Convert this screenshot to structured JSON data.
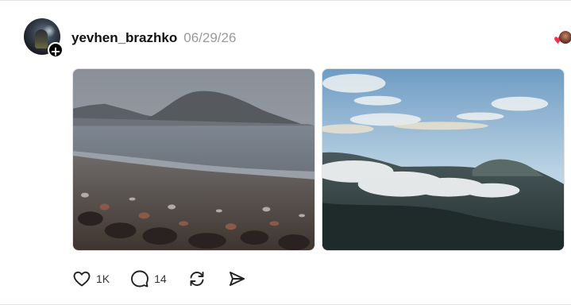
{
  "post": {
    "username": "yevhen_brazhko",
    "date": "06/29/26"
  },
  "author": {
    "follow_symbol": "+"
  },
  "reaction_preview": {
    "icon": "heart-icon",
    "color": "#ff2a4a"
  },
  "media": [
    {
      "icon": "photo",
      "subject": "pebble beach with mountain"
    },
    {
      "icon": "photo",
      "subject": "clouds over mountain coast"
    }
  ],
  "actions": {
    "like": {
      "icon": "heart-icon",
      "count": "1K"
    },
    "reply": {
      "icon": "comment-icon",
      "count": "14"
    },
    "repost": {
      "icon": "repost-icon"
    },
    "share": {
      "icon": "send-icon"
    }
  },
  "colors": {
    "text_primary": "#111111",
    "text_secondary": "#9a9a9a",
    "heart_accent": "#ff2a4a"
  }
}
